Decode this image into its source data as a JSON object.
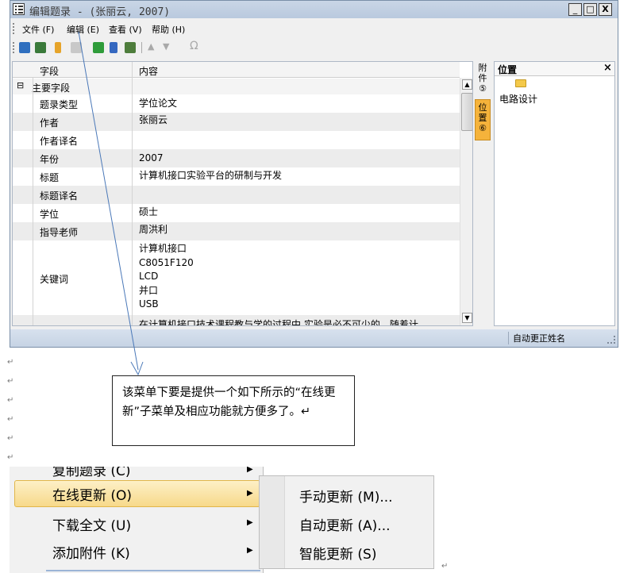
{
  "window": {
    "title": "编辑题录 - (张丽云, 2007)",
    "controls": [
      "_",
      "□",
      "X"
    ]
  },
  "menubar": {
    "items": [
      "文件 (F)",
      "编辑 (E)",
      "查看 (V)",
      "帮助 (H)"
    ]
  },
  "toolbar": {
    "icons": [
      "save-icon",
      "save-all-icon",
      "edit-icon",
      "clear-icon",
      "grid-icon",
      "pin-icon",
      "import-icon",
      "up-icon",
      "down-icon",
      "omega-icon"
    ],
    "omega": "Ω"
  },
  "grid": {
    "header": {
      "field": "字段",
      "content": "内容"
    },
    "group": {
      "toggle": "⊟",
      "label": "主要字段"
    },
    "rows": [
      {
        "field": "题录类型",
        "value": "学位论文"
      },
      {
        "field": "作者",
        "value": "张丽云"
      },
      {
        "field": "作者译名",
        "value": ""
      },
      {
        "field": "年份",
        "value": "2007"
      },
      {
        "field": "标题",
        "value": "计算机接口实验平台的研制与开发"
      },
      {
        "field": "标题译名",
        "value": ""
      },
      {
        "field": "学位",
        "value": "硕士"
      },
      {
        "field": "指导老师",
        "value": "周洪利"
      },
      {
        "field": "关键词",
        "value": "计算机接口\nC8051F120\nLCD\n并口\nUSB"
      },
      {
        "field": "",
        "value": "在计算机接口技术课程教与学的过程中,实验是必不可少的。随着计"
      }
    ]
  },
  "sidetabs": {
    "attach": "附件",
    "attach_num": "⑤",
    "location": "位置",
    "location_num": "⑥"
  },
  "location_panel": {
    "title": "位置",
    "close": "×",
    "folder_icon": "folder-icon",
    "item": "电路设计"
  },
  "statusbar": {
    "text": "自动更正姓名"
  },
  "callout": {
    "text": "该菜单下要是提供一个如下所示的“在线更新”子菜单及相应功能就方便多了。↵"
  },
  "paragraph_marks": [
    "↵",
    "↵",
    "↵",
    "↵",
    "↵",
    "↵"
  ],
  "context_menu": {
    "items": [
      {
        "label": "复制题录 (C)",
        "arrow": "▶"
      },
      {
        "label": "在线更新 (O)",
        "arrow": "▶"
      },
      {
        "label": "下载全文 (U)",
        "arrow": "▶"
      },
      {
        "label": "添加附件 (K)",
        "arrow": "▶"
      }
    ],
    "submenu": [
      {
        "label": "手动更新 (M)..."
      },
      {
        "label": "自动更新 (A)..."
      },
      {
        "label": "智能更新 (S)"
      }
    ],
    "end_mark": "↵"
  },
  "colors": {
    "title_bg": "#c3d2e5",
    "highlight": "#f7d98a",
    "accent_orange": "#f5b33b"
  }
}
